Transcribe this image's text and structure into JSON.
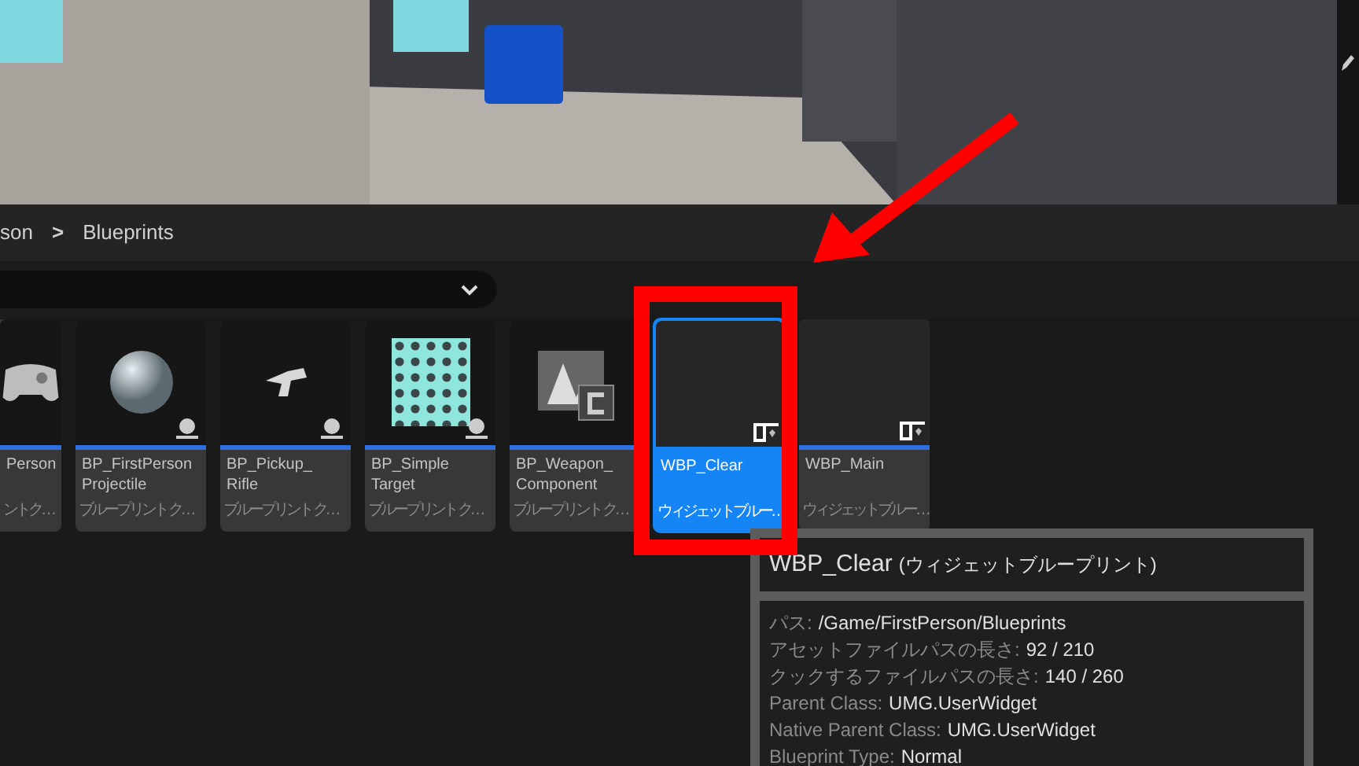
{
  "breadcrumb": [
    {
      "label": "son"
    },
    {
      "label": "Blueprints"
    }
  ],
  "breadcrumb_separator": ">",
  "tiles": [
    {
      "kind": "gamepad",
      "name": "Person",
      "type": "ントク…",
      "selected": false
    },
    {
      "kind": "sphere",
      "name": "BP_FirstPerson Projectile",
      "type": "ブループリント ク…",
      "selected": false
    },
    {
      "kind": "rifle",
      "name": "BP_Pickup_ Rifle",
      "type": "ブループリント ク…",
      "selected": false
    },
    {
      "kind": "hexagon",
      "name": "BP_Simple Target",
      "type": "ブループリント ク…",
      "selected": false
    },
    {
      "kind": "component",
      "name": "BP_Weapon_ Component",
      "type": "ブループリント ク…",
      "selected": false
    },
    {
      "kind": "widget",
      "name": "WBP_Clear",
      "type": "ウィジェットブルー…",
      "selected": true
    },
    {
      "kind": "widget",
      "name": "WBP_Main",
      "type": "ウィジェットブルー…",
      "selected": false
    }
  ],
  "tooltip": {
    "name": "WBP_Clear",
    "type": "(ウィジェットブループリント)",
    "rows": [
      {
        "label": "パス:",
        "value": "/Game/FirstPerson/Blueprints"
      },
      {
        "label": "アセットファイルパスの長さ:",
        "value": "92 / 210"
      },
      {
        "label": "クックするファイルパスの長さ:",
        "value": "140 / 260"
      },
      {
        "label": "Parent Class:",
        "value": "UMG.UserWidget"
      },
      {
        "label": "Native Parent Class:",
        "value": "UMG.UserWidget"
      },
      {
        "label": "Blueprint Type:",
        "value": "Normal"
      }
    ]
  }
}
